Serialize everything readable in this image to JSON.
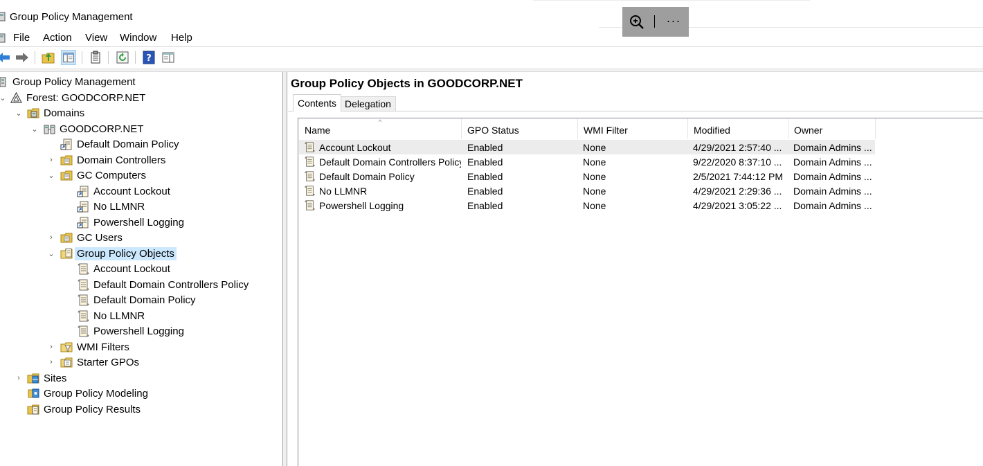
{
  "window": {
    "title": "Group Policy Management"
  },
  "menu": [
    "File",
    "Action",
    "View",
    "Window",
    "Help"
  ],
  "toolbar": {
    "buttons": [
      "back-icon",
      "forward-icon",
      "up-folder-icon",
      "show-hide-tree-icon",
      "clipboard-icon",
      "refresh-icon",
      "help-icon",
      "properties-pane-icon"
    ]
  },
  "tree": {
    "root": "Group Policy Management",
    "forest": "Forest: GOODCORP.NET",
    "domains": "Domains",
    "domain": "GOODCORP.NET",
    "default_domain_policy": "Default Domain Policy",
    "domain_controllers": "Domain Controllers",
    "gc_computers": "GC Computers",
    "gc_computers_children": [
      "Account Lockout",
      "No LLMNR",
      "Powershell Logging"
    ],
    "gc_users": "GC Users",
    "gpo_container": "Group Policy Objects",
    "gpo_children": [
      "Account Lockout",
      "Default Domain Controllers Policy",
      "Default Domain Policy",
      "No LLMNR",
      "Powershell Logging"
    ],
    "wmi_filters": "WMI Filters",
    "starter_gpos": "Starter GPOs",
    "sites": "Sites",
    "modeling": "Group Policy Modeling",
    "results": "Group Policy Results"
  },
  "main": {
    "title": "Group Policy Objects in GOODCORP.NET",
    "tabs": [
      "Contents",
      "Delegation"
    ],
    "columns": [
      "Name",
      "GPO Status",
      "WMI Filter",
      "Modified",
      "Owner"
    ],
    "rows": [
      [
        "Account Lockout",
        "Enabled",
        "None",
        "4/29/2021 2:57:40 ...",
        "Domain Admins ..."
      ],
      [
        "Default Domain Controllers Policy",
        "Enabled",
        "None",
        "9/22/2020 8:37:10 ...",
        "Domain Admins ..."
      ],
      [
        "Default Domain Policy",
        "Enabled",
        "None",
        "2/5/2021 7:44:12 PM",
        "Domain Admins ..."
      ],
      [
        "No LLMNR",
        "Enabled",
        "None",
        "4/29/2021 2:29:36 ...",
        "Domain Admins ..."
      ],
      [
        "Powershell Logging",
        "Enabled",
        "None",
        "4/29/2021 3:05:22 ...",
        "Domain Admins ..."
      ]
    ]
  },
  "colors": {
    "selection": "#cce8ff",
    "toolbar_pressed": "#cce4f7",
    "zoom_tool_bg": "#9e9e9e"
  }
}
